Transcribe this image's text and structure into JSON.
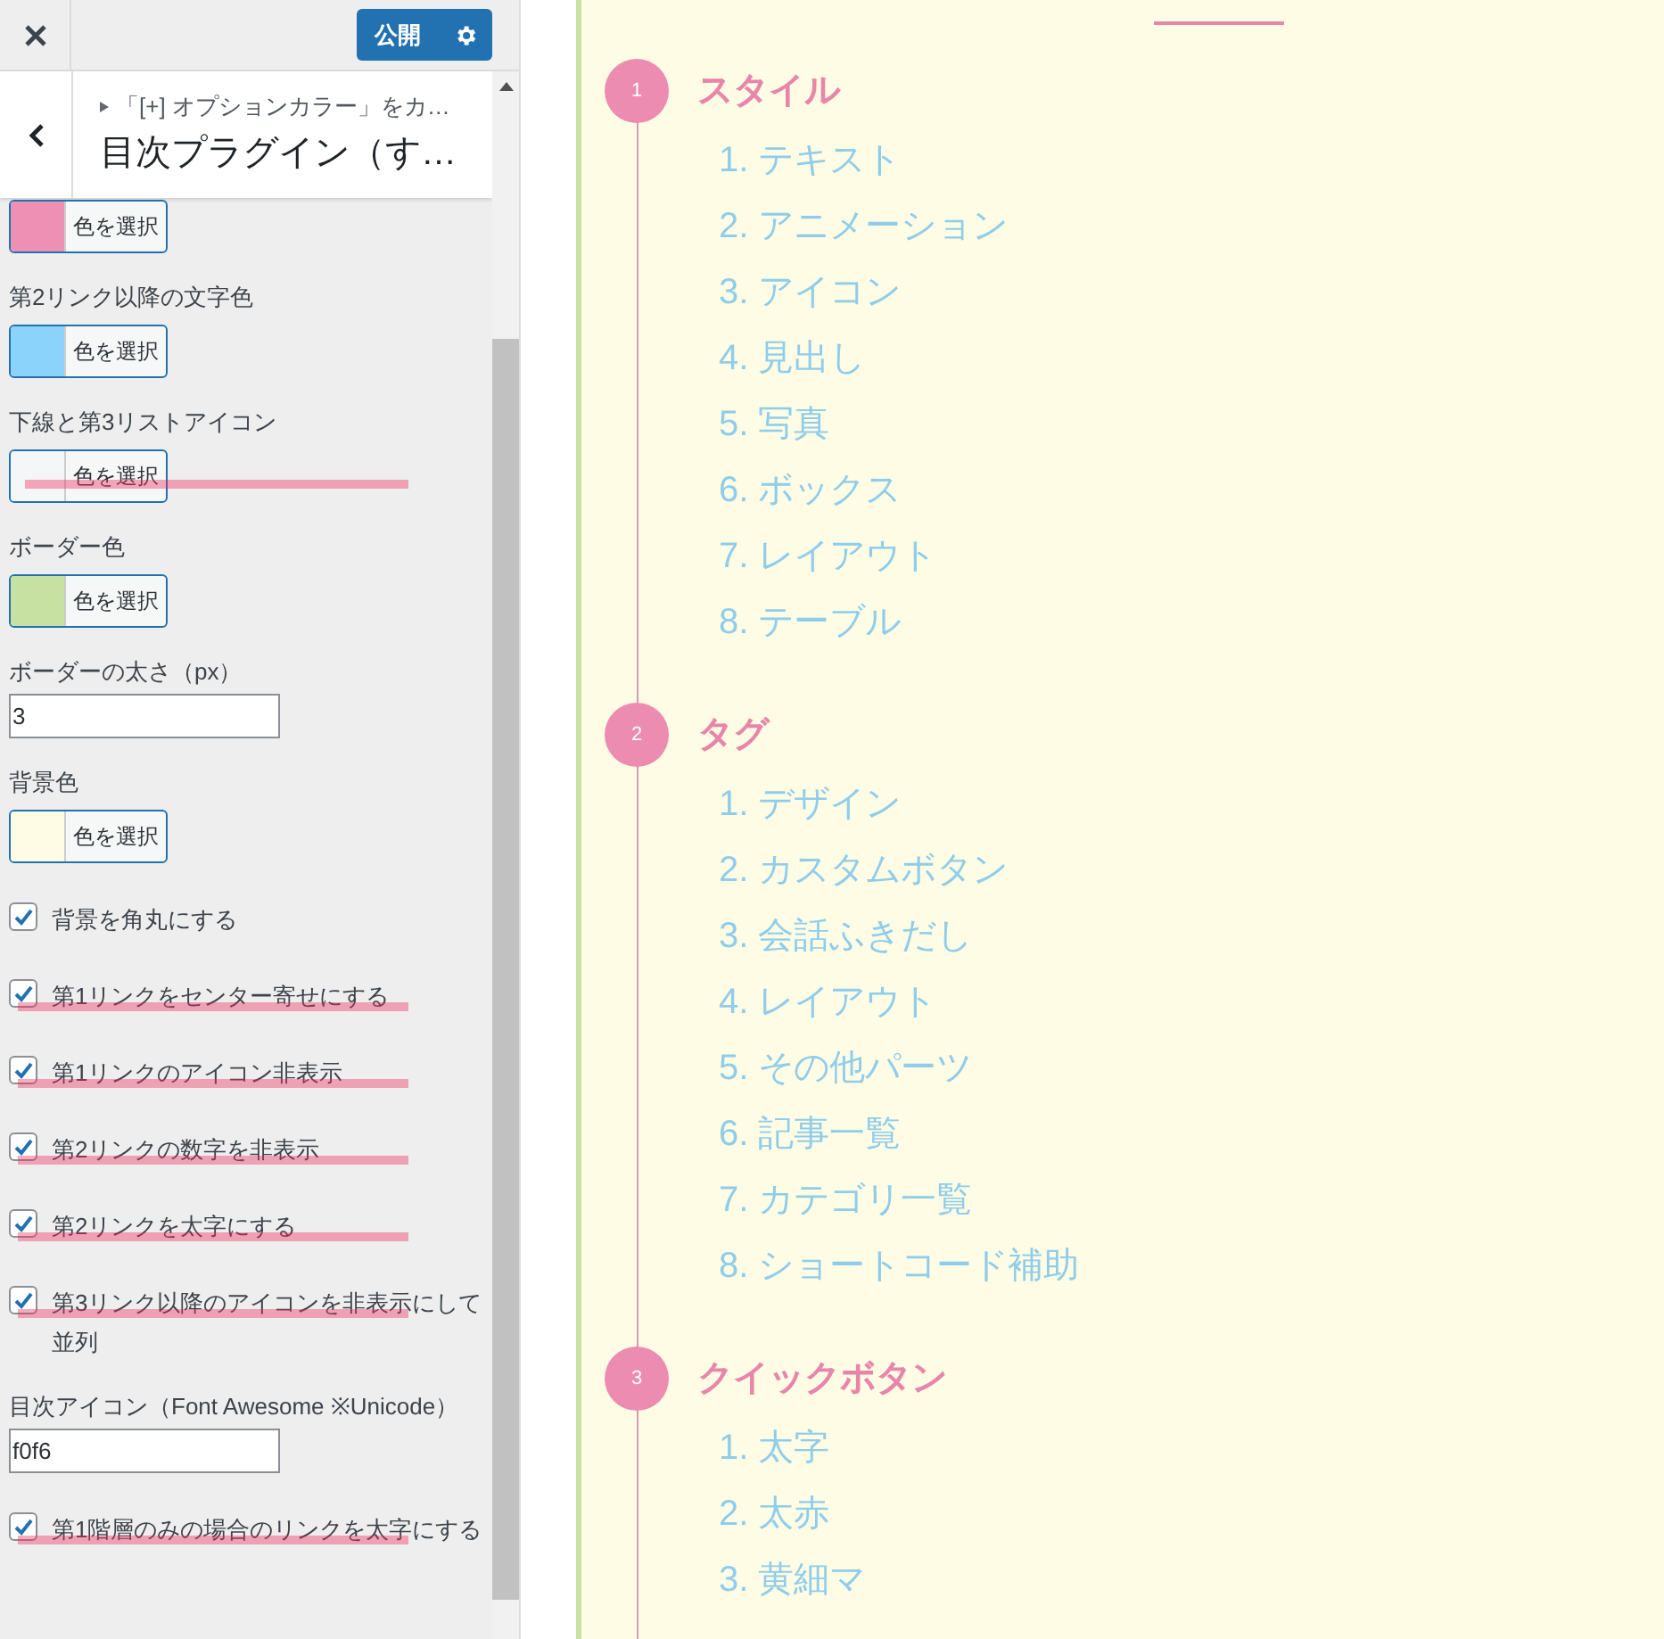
{
  "sidebar": {
    "publish_button": "公開",
    "breadcrumb": "「[+] オプションカラー」をカ…",
    "title": "目次プラグイン（す…",
    "controls": [
      {
        "kind": "color",
        "color": "#ee8fb4",
        "button": "色を選択",
        "struck": false
      },
      {
        "kind": "color",
        "label": "第2リンク以降の文字色",
        "color": "#8cd3fb",
        "button": "色を選択",
        "struck": false
      },
      {
        "kind": "color",
        "label": "下線と第3リストアイコン",
        "color": "#f4f6f7",
        "button": "色を選択",
        "struck": true
      },
      {
        "kind": "color",
        "label": "ボーダー色",
        "color": "#c6e1a2",
        "button": "色を選択",
        "struck": false
      },
      {
        "kind": "text",
        "label": "ボーダーの太さ（px）",
        "value": "3"
      },
      {
        "kind": "color",
        "label": "背景色",
        "color": "#fefce4",
        "button": "色を選択",
        "struck": false
      },
      {
        "kind": "checkbox",
        "label": "背景を角丸にする",
        "checked": true,
        "struck": false
      },
      {
        "kind": "checkbox",
        "label": "第1リンクをセンター寄せにする",
        "checked": true,
        "struck": true
      },
      {
        "kind": "checkbox",
        "label": "第1リンクのアイコン非表示",
        "checked": true,
        "struck": true
      },
      {
        "kind": "checkbox",
        "label": "第2リンクの数字を非表示",
        "checked": true,
        "struck": true
      },
      {
        "kind": "checkbox",
        "label": "第2リンクを太字にする",
        "checked": true,
        "struck": true
      },
      {
        "kind": "checkbox",
        "label": "第3リンク以降のアイコンを非表示にして並列",
        "checked": true,
        "struck": true
      },
      {
        "kind": "text",
        "label": "目次アイコン（Font Awesome ※Unicode）",
        "value": "f0f6"
      },
      {
        "kind": "checkbox",
        "label": "第1階層のみの場合のリンクを太字にする",
        "checked": true,
        "struck": true
      }
    ]
  },
  "toc": {
    "sections": [
      {
        "number": "1",
        "title": "スタイル",
        "items": [
          "1. テキスト",
          "2. アニメーション",
          "3. アイコン",
          "4. 見出し",
          "5. 写真",
          "6. ボックス",
          "7. レイアウト",
          "8. テーブル"
        ]
      },
      {
        "number": "2",
        "title": "タグ",
        "items": [
          "1. デザイン",
          "2. カスタムボタン",
          "3. 会話ふきだし",
          "4. レイアウト",
          "5. その他パーツ",
          "6. 記事一覧",
          "7. カテゴリ一覧",
          "8. ショートコード補助"
        ]
      },
      {
        "number": "3",
        "title": "クイックボタン",
        "items": [
          "1. 太字",
          "2. 太赤",
          "3. 黄細マ"
        ]
      }
    ]
  }
}
